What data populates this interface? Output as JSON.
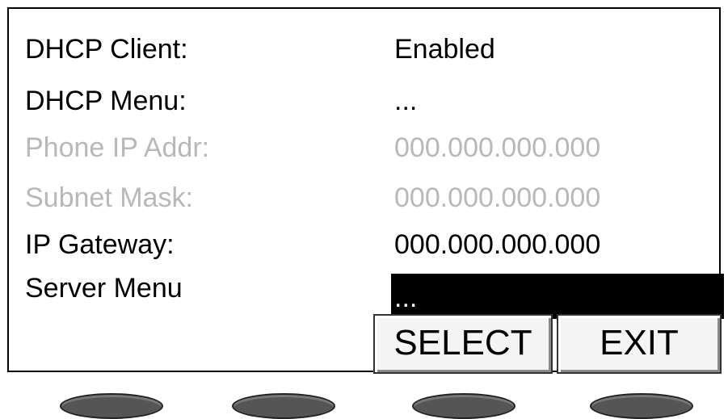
{
  "menu": {
    "rows": [
      {
        "label": "DHCP Client:",
        "value": "Enabled",
        "state": "normal"
      },
      {
        "label": "DHCP Menu:",
        "value": "...",
        "state": "normal"
      },
      {
        "label": "Phone IP Addr:",
        "value": "000.000.000.000",
        "state": "disabled"
      },
      {
        "label": "Subnet Mask:",
        "value": "000.000.000.000",
        "state": "disabled"
      },
      {
        "label": "IP Gateway:",
        "value": "000.000.000.000",
        "state": "normal"
      },
      {
        "label": "Server Menu",
        "value": "...",
        "state": "selected"
      }
    ]
  },
  "softkeys": {
    "select_label": "SELECT",
    "exit_label": "EXIT"
  },
  "hardware_buttons": {
    "icon": "oval-button"
  },
  "colors": {
    "text": "#000000",
    "disabled_text": "#b8b8b8",
    "highlight_bg": "#000000",
    "highlight_text": "#ffffff",
    "button": "#555555"
  }
}
